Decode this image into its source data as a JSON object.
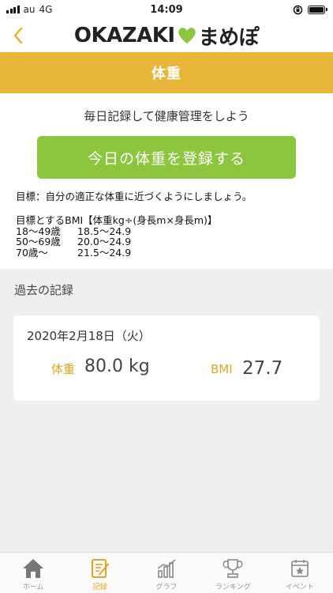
{
  "status_bar": {
    "carrier": "au",
    "network": "4G",
    "time": "14:09"
  },
  "header": {
    "back_icon": "chevron-left-icon",
    "logo_left": "OKAZAKI",
    "logo_right": "まめぽ"
  },
  "page": {
    "title": "体重",
    "subtitle": "毎日記録して健康管理をしよう",
    "register_button": "今日の体重を登録する",
    "goal_text": "目標：自分の適正な体重に近づくようにしましょう。",
    "bmi_goal_title": "目標とするBMI【体重kg÷(身長m×身長m)】",
    "bmi_ranges": [
      {
        "age": "18〜49歳",
        "range": "18.5〜24.9"
      },
      {
        "age": "50〜69歳",
        "range": "20.0〜24.9"
      },
      {
        "age": "70歳〜",
        "range": "21.5〜24.9"
      }
    ]
  },
  "records": {
    "title": "過去の記録",
    "items": [
      {
        "date": "2020年2月18日（火）",
        "weight_label": "体重",
        "weight": "80.0 kg",
        "bmi_label": "BMI",
        "bmi": "27.7"
      }
    ]
  },
  "tabs": [
    {
      "label": "ホーム",
      "icon": "home-icon",
      "active": false
    },
    {
      "label": "記録",
      "icon": "notebook-pencil-icon",
      "active": true
    },
    {
      "label": "グラフ",
      "icon": "bar-chart-icon",
      "active": false
    },
    {
      "label": "ランキング",
      "icon": "trophy-icon",
      "active": false
    },
    {
      "label": "イベント",
      "icon": "calendar-star-icon",
      "active": false
    }
  ],
  "colors": {
    "accent": "#e8b73a",
    "button": "#8cc63f",
    "label": "#e3a51f",
    "logo_heart": "#8cc63f"
  }
}
